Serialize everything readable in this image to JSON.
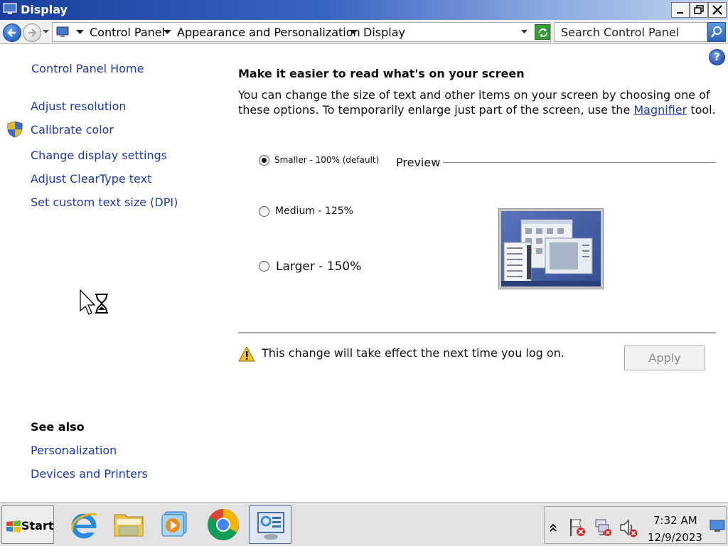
{
  "window": {
    "title": "Display",
    "controls": {
      "minimize": "minimize",
      "maximize": "restore",
      "close": "close"
    }
  },
  "address": {
    "breadcrumbs": [
      "Control Panel",
      "Appearance and Personalization",
      "Display"
    ],
    "search_placeholder": "Search Control Panel"
  },
  "left_pane": {
    "home_link": "Control Panel Home",
    "links": [
      "Adjust resolution",
      "Calibrate color",
      "Change display settings",
      "Adjust ClearType text",
      "Set custom text size (DPI)"
    ],
    "see_also_heading": "See also",
    "see_also_links": [
      "Personalization",
      "Devices and Printers"
    ]
  },
  "main": {
    "heading": "Make it easier to read what's on your screen",
    "description_before": "You can change the size of text and other items on your screen by choosing one of these options. To temporarily enlarge just part of the screen, use the ",
    "magnifier_link": "Magnifier",
    "description_after": " tool.",
    "options": [
      {
        "label": "Smaller - 100% (default)",
        "selected": true
      },
      {
        "label": "Medium - 125%",
        "selected": false
      },
      {
        "label": "Larger - 150%",
        "selected": false
      }
    ],
    "preview_label": "Preview",
    "warning": "This change will take effect the next time you log on.",
    "apply_label": "Apply"
  },
  "taskbar": {
    "start_label": "Start",
    "apps": [
      "internet-explorer-icon",
      "file-explorer-icon",
      "media-player-icon",
      "chrome-icon",
      "control-panel-icon"
    ],
    "clock_time": "7:32 AM",
    "clock_date": "12/9/2023"
  },
  "colors": {
    "link": "#1c3aa9",
    "titlebar": "#1a3f9e"
  }
}
